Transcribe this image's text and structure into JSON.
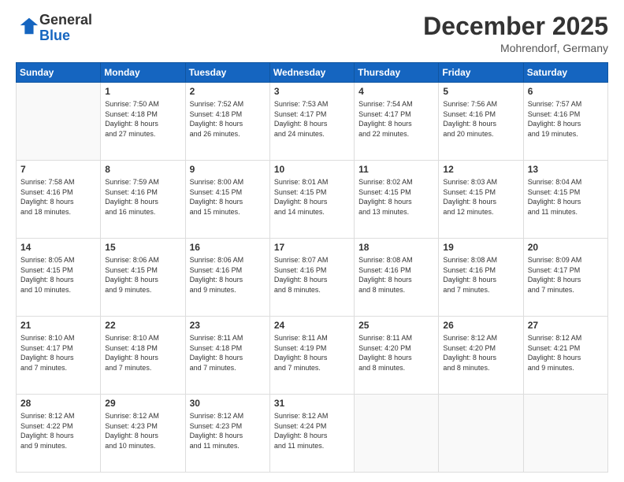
{
  "header": {
    "logo_general": "General",
    "logo_blue": "Blue",
    "month_title": "December 2025",
    "location": "Mohrendorf, Germany"
  },
  "days_of_week": [
    "Sunday",
    "Monday",
    "Tuesday",
    "Wednesday",
    "Thursday",
    "Friday",
    "Saturday"
  ],
  "weeks": [
    [
      {
        "day": "",
        "info": ""
      },
      {
        "day": "1",
        "info": "Sunrise: 7:50 AM\nSunset: 4:18 PM\nDaylight: 8 hours\nand 27 minutes."
      },
      {
        "day": "2",
        "info": "Sunrise: 7:52 AM\nSunset: 4:18 PM\nDaylight: 8 hours\nand 26 minutes."
      },
      {
        "day": "3",
        "info": "Sunrise: 7:53 AM\nSunset: 4:17 PM\nDaylight: 8 hours\nand 24 minutes."
      },
      {
        "day": "4",
        "info": "Sunrise: 7:54 AM\nSunset: 4:17 PM\nDaylight: 8 hours\nand 22 minutes."
      },
      {
        "day": "5",
        "info": "Sunrise: 7:56 AM\nSunset: 4:16 PM\nDaylight: 8 hours\nand 20 minutes."
      },
      {
        "day": "6",
        "info": "Sunrise: 7:57 AM\nSunset: 4:16 PM\nDaylight: 8 hours\nand 19 minutes."
      }
    ],
    [
      {
        "day": "7",
        "info": "Sunrise: 7:58 AM\nSunset: 4:16 PM\nDaylight: 8 hours\nand 18 minutes."
      },
      {
        "day": "8",
        "info": "Sunrise: 7:59 AM\nSunset: 4:16 PM\nDaylight: 8 hours\nand 16 minutes."
      },
      {
        "day": "9",
        "info": "Sunrise: 8:00 AM\nSunset: 4:15 PM\nDaylight: 8 hours\nand 15 minutes."
      },
      {
        "day": "10",
        "info": "Sunrise: 8:01 AM\nSunset: 4:15 PM\nDaylight: 8 hours\nand 14 minutes."
      },
      {
        "day": "11",
        "info": "Sunrise: 8:02 AM\nSunset: 4:15 PM\nDaylight: 8 hours\nand 13 minutes."
      },
      {
        "day": "12",
        "info": "Sunrise: 8:03 AM\nSunset: 4:15 PM\nDaylight: 8 hours\nand 12 minutes."
      },
      {
        "day": "13",
        "info": "Sunrise: 8:04 AM\nSunset: 4:15 PM\nDaylight: 8 hours\nand 11 minutes."
      }
    ],
    [
      {
        "day": "14",
        "info": "Sunrise: 8:05 AM\nSunset: 4:15 PM\nDaylight: 8 hours\nand 10 minutes."
      },
      {
        "day": "15",
        "info": "Sunrise: 8:06 AM\nSunset: 4:15 PM\nDaylight: 8 hours\nand 9 minutes."
      },
      {
        "day": "16",
        "info": "Sunrise: 8:06 AM\nSunset: 4:16 PM\nDaylight: 8 hours\nand 9 minutes."
      },
      {
        "day": "17",
        "info": "Sunrise: 8:07 AM\nSunset: 4:16 PM\nDaylight: 8 hours\nand 8 minutes."
      },
      {
        "day": "18",
        "info": "Sunrise: 8:08 AM\nSunset: 4:16 PM\nDaylight: 8 hours\nand 8 minutes."
      },
      {
        "day": "19",
        "info": "Sunrise: 8:08 AM\nSunset: 4:16 PM\nDaylight: 8 hours\nand 7 minutes."
      },
      {
        "day": "20",
        "info": "Sunrise: 8:09 AM\nSunset: 4:17 PM\nDaylight: 8 hours\nand 7 minutes."
      }
    ],
    [
      {
        "day": "21",
        "info": "Sunrise: 8:10 AM\nSunset: 4:17 PM\nDaylight: 8 hours\nand 7 minutes."
      },
      {
        "day": "22",
        "info": "Sunrise: 8:10 AM\nSunset: 4:18 PM\nDaylight: 8 hours\nand 7 minutes."
      },
      {
        "day": "23",
        "info": "Sunrise: 8:11 AM\nSunset: 4:18 PM\nDaylight: 8 hours\nand 7 minutes."
      },
      {
        "day": "24",
        "info": "Sunrise: 8:11 AM\nSunset: 4:19 PM\nDaylight: 8 hours\nand 7 minutes."
      },
      {
        "day": "25",
        "info": "Sunrise: 8:11 AM\nSunset: 4:20 PM\nDaylight: 8 hours\nand 8 minutes."
      },
      {
        "day": "26",
        "info": "Sunrise: 8:12 AM\nSunset: 4:20 PM\nDaylight: 8 hours\nand 8 minutes."
      },
      {
        "day": "27",
        "info": "Sunrise: 8:12 AM\nSunset: 4:21 PM\nDaylight: 8 hours\nand 9 minutes."
      }
    ],
    [
      {
        "day": "28",
        "info": "Sunrise: 8:12 AM\nSunset: 4:22 PM\nDaylight: 8 hours\nand 9 minutes."
      },
      {
        "day": "29",
        "info": "Sunrise: 8:12 AM\nSunset: 4:23 PM\nDaylight: 8 hours\nand 10 minutes."
      },
      {
        "day": "30",
        "info": "Sunrise: 8:12 AM\nSunset: 4:23 PM\nDaylight: 8 hours\nand 11 minutes."
      },
      {
        "day": "31",
        "info": "Sunrise: 8:12 AM\nSunset: 4:24 PM\nDaylight: 8 hours\nand 11 minutes."
      },
      {
        "day": "",
        "info": ""
      },
      {
        "day": "",
        "info": ""
      },
      {
        "day": "",
        "info": ""
      }
    ]
  ]
}
